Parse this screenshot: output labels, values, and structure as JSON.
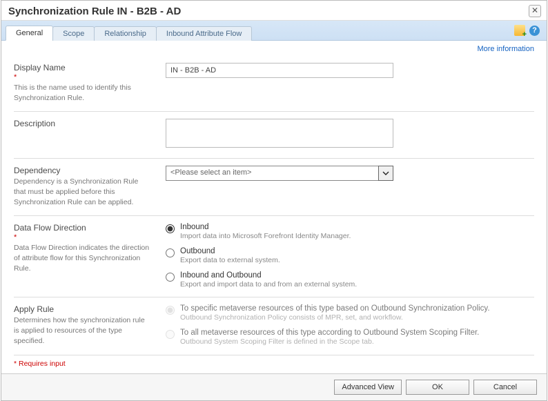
{
  "title": "Synchronization Rule IN - B2B - AD",
  "tabs": [
    "General",
    "Scope",
    "Relationship",
    "Inbound Attribute Flow"
  ],
  "active_tab_index": 0,
  "more_information_label": "More information",
  "fields": {
    "display_name": {
      "label": "Display Name",
      "help": "This is the name used to identify this Synchronization Rule.",
      "value": "IN - B2B - AD",
      "required": true
    },
    "description": {
      "label": "Description",
      "value": ""
    },
    "dependency": {
      "label": "Dependency",
      "help": "Dependency is a Synchronization Rule that must be applied before this Synchronization Rule can be applied.",
      "placeholder": "<Please select an item>"
    },
    "data_flow": {
      "label": "Data Flow Direction",
      "help": "Data Flow Direction indicates the direction of attribute flow for this Synchronization Rule.",
      "required": true,
      "options": [
        {
          "title": "Inbound",
          "desc": "Import data into Microsoft Forefront Identity Manager.",
          "checked": true
        },
        {
          "title": "Outbound",
          "desc": "Export data to external system.",
          "checked": false
        },
        {
          "title": "Inbound and Outbound",
          "desc": "Export and import data to and from an external system.",
          "checked": false
        }
      ]
    },
    "apply_rule": {
      "label": "Apply Rule",
      "help": "Determines how the synchronization rule is applied to resources of the type specified.",
      "options": [
        {
          "title": "To specific metaverse resources of this type based on Outbound Synchronization Policy.",
          "desc": "Outbound Synchronization Policy consists of MPR, set, and workflow.",
          "checked": true,
          "disabled": true
        },
        {
          "title": "To all metaverse resources of this type according to Outbound System Scoping Filter.",
          "desc": "Outbound System Scoping Filter is defined in the Scope tab.",
          "checked": false,
          "disabled": true
        }
      ]
    }
  },
  "requires_input_label": "* Requires input",
  "buttons": {
    "advanced": "Advanced View",
    "ok": "OK",
    "cancel": "Cancel"
  }
}
